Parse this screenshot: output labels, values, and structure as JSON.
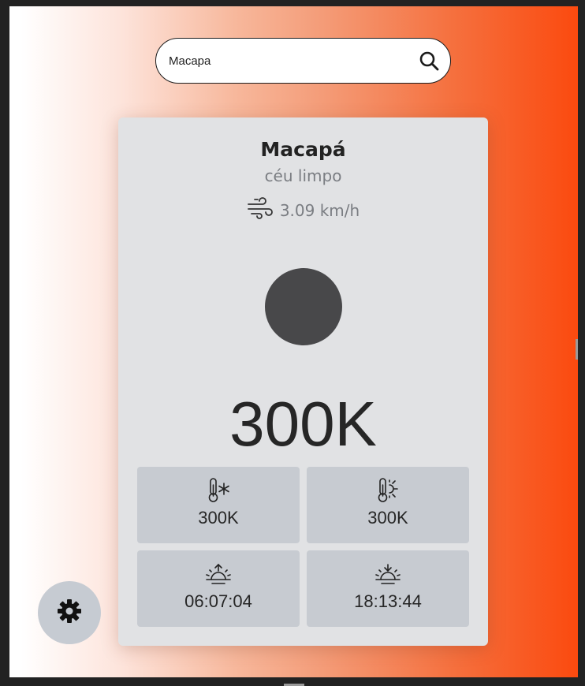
{
  "search": {
    "value": "Macapa",
    "icon": "search-icon"
  },
  "weather": {
    "city": "Macapá",
    "description": "céu limpo",
    "wind": "3.09 km/h",
    "wind_icon": "wind-icon",
    "condition_icon": "weather-condition-icon",
    "temperature": "300K"
  },
  "details": {
    "temp_min": {
      "icon": "thermometer-cold-icon",
      "value": "300K"
    },
    "temp_max": {
      "icon": "thermometer-hot-icon",
      "value": "300K"
    },
    "sunrise": {
      "icon": "sunrise-icon",
      "value": "06:07:04"
    },
    "sunset": {
      "icon": "sunset-icon",
      "value": "18:13:44"
    }
  },
  "settings": {
    "icon": "gear-icon"
  },
  "colors": {
    "gradient_start": "#ffffff",
    "gradient_end": "#fb4a0f",
    "card": "#e1e2e4",
    "tile": "#c7cbd1",
    "weather_icon": "#48484a"
  }
}
